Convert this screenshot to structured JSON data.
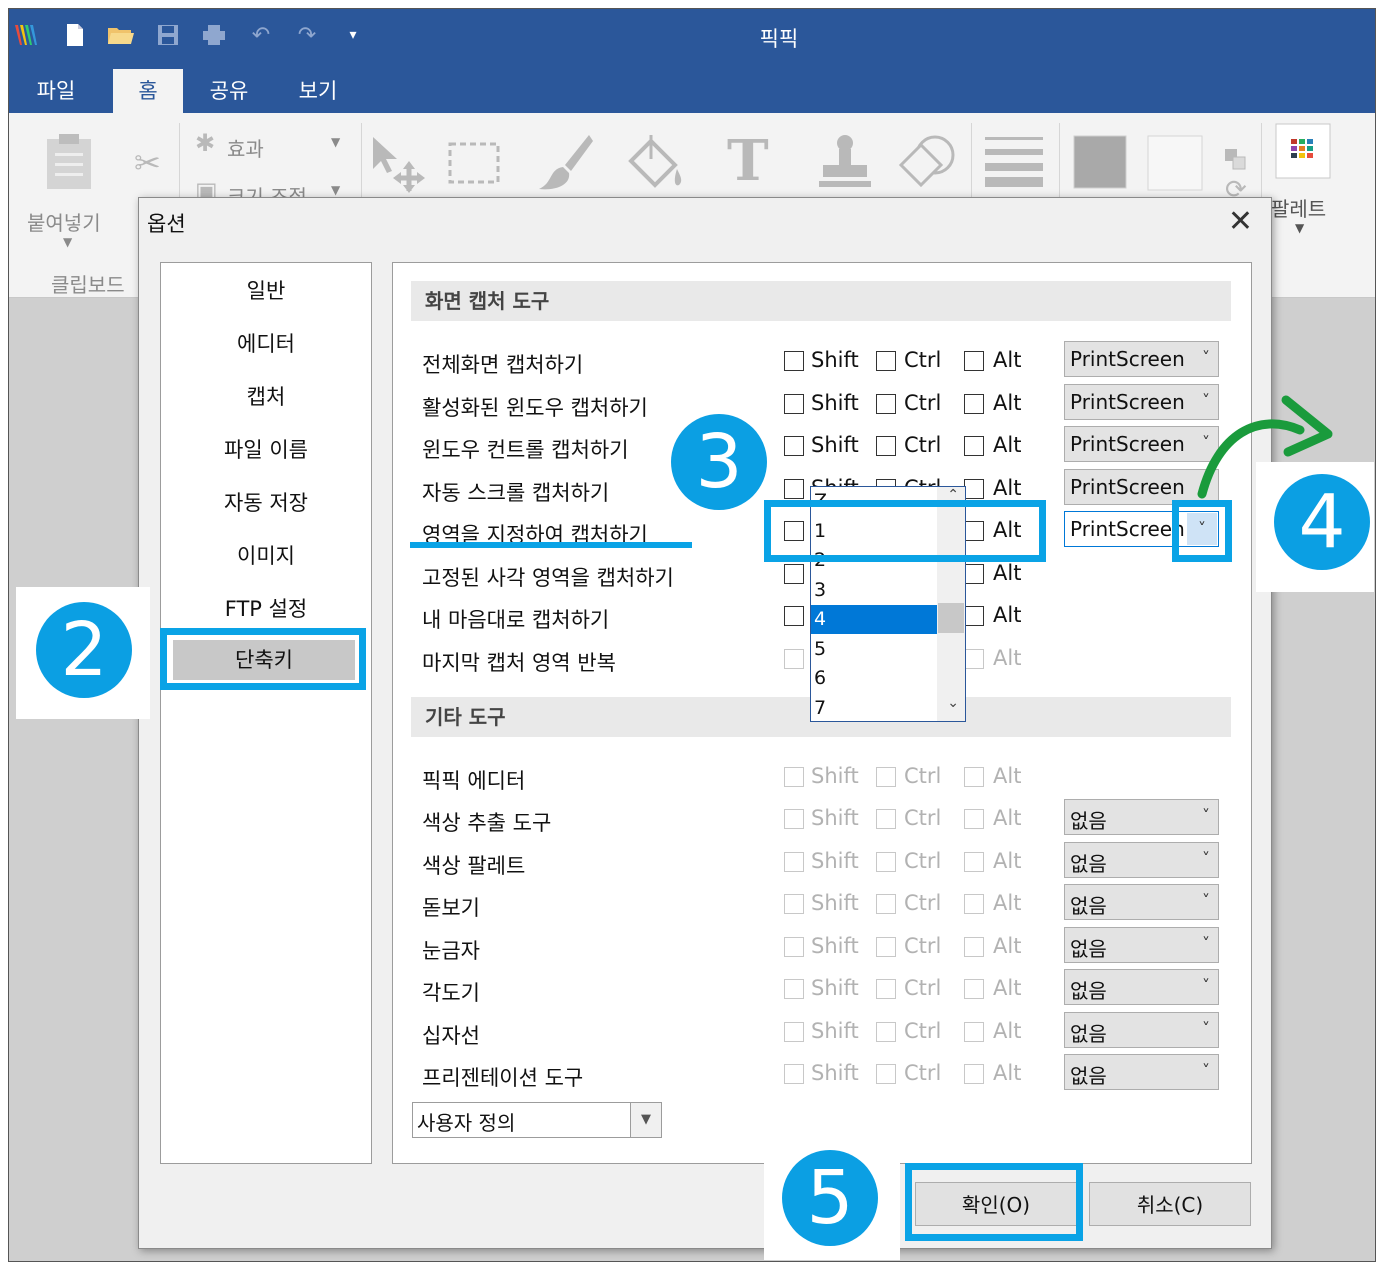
{
  "window": {
    "title": "픽픽"
  },
  "quick_access": [
    "picpick-logo-icon",
    "new-file-icon",
    "open-folder-icon",
    "save-icon",
    "print-icon",
    "undo-icon",
    "redo-icon",
    "customize-dropdown-icon"
  ],
  "ribbon_tabs": [
    {
      "label": "파일",
      "active": false
    },
    {
      "label": "홈",
      "active": true
    },
    {
      "label": "공유",
      "active": false
    },
    {
      "label": "보기",
      "active": false
    }
  ],
  "ribbon": {
    "paste_label": "붙여넣기",
    "clipboard_group": "클립보드",
    "effects_label": "효과",
    "resize_label": "크기 조절",
    "palette_label": "팔레트"
  },
  "dialog": {
    "title": "옵션",
    "nav": [
      "일반",
      "에디터",
      "캡처",
      "파일 이름",
      "자동 저장",
      "이미지",
      "FTP 설정",
      "단축키"
    ],
    "selected_nav": "단축키",
    "section1": "화면 캡처 도구",
    "section2": "기타 도구",
    "modifiers": [
      "Shift",
      "Ctrl",
      "Alt"
    ],
    "capture_rows": [
      {
        "label": "전체화면 캡처하기",
        "shift": false,
        "ctrl": false,
        "alt": false,
        "enabled": true,
        "key": "PrintScreen"
      },
      {
        "label": "활성화된 윈도우 캡처하기",
        "shift": false,
        "ctrl": false,
        "alt": false,
        "enabled": true,
        "key": "PrintScreen"
      },
      {
        "label": "윈도우 컨트롤 캡처하기",
        "shift": false,
        "ctrl": false,
        "alt": false,
        "enabled": true,
        "key": "PrintScreen"
      },
      {
        "label": "자동 스크롤 캡처하기",
        "shift": false,
        "ctrl": false,
        "alt": false,
        "enabled": true,
        "key": "PrintScreen"
      },
      {
        "label": "영역을 지정하여 캡처하기",
        "shift": false,
        "ctrl": true,
        "alt": false,
        "enabled": true,
        "key": "PrintScreen"
      },
      {
        "label": "고정된 사각 영역을 캡처하기",
        "shift": false,
        "ctrl": false,
        "alt": false,
        "enabled": true,
        "key": ""
      },
      {
        "label": "내 마음대로 캡처하기",
        "shift": false,
        "ctrl": false,
        "alt": false,
        "enabled": true,
        "key": ""
      },
      {
        "label": "마지막 캡처 영역 반복",
        "shift": false,
        "ctrl": false,
        "alt": false,
        "enabled": false,
        "key": ""
      }
    ],
    "dropdown_options": [
      "Z",
      "1",
      "2",
      "3",
      "4",
      "5",
      "6",
      "7"
    ],
    "dropdown_selected": "4",
    "tool_rows": [
      {
        "label": "픽픽 에디터",
        "key": ""
      },
      {
        "label": "색상 추출 도구",
        "key": "없음"
      },
      {
        "label": "색상 팔레트",
        "key": "없음"
      },
      {
        "label": "돋보기",
        "key": "없음"
      },
      {
        "label": "눈금자",
        "key": "없음"
      },
      {
        "label": "각도기",
        "key": "없음"
      },
      {
        "label": "십자선",
        "key": "없음"
      },
      {
        "label": "프리젠테이션 도구",
        "key": "없음"
      }
    ],
    "preset": "사용자 정의",
    "ok": "확인(O)",
    "cancel": "취소(C)"
  },
  "annotations": {
    "steps": [
      "2",
      "3",
      "4",
      "5"
    ],
    "color": "#0aa3e6",
    "arrow_color": "#1a9b3c"
  }
}
